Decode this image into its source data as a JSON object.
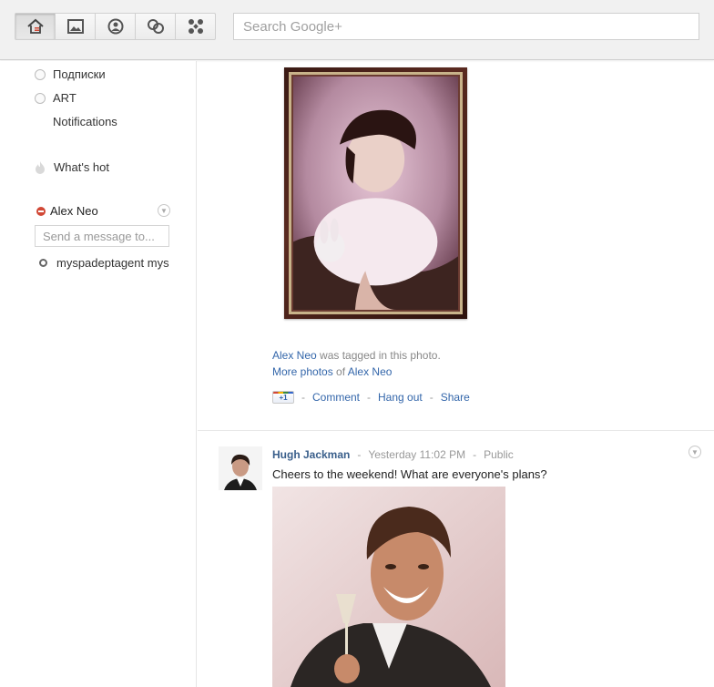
{
  "search": {
    "placeholder": "Search Google+"
  },
  "nav": {
    "buttons": [
      {
        "icon": "home-icon",
        "active": true
      },
      {
        "icon": "photos-icon",
        "active": false
      },
      {
        "icon": "profile-icon",
        "active": false
      },
      {
        "icon": "circles-icon",
        "active": false
      },
      {
        "icon": "games-icon",
        "active": false
      }
    ]
  },
  "sidebar": {
    "streams": [
      {
        "label": "Подписки"
      },
      {
        "label": "ART"
      },
      {
        "label": "Notifications"
      }
    ],
    "whats_hot": "What's hot",
    "chat": {
      "user_name": "Alex Neo",
      "message_placeholder": "Send a message to...",
      "contacts": [
        {
          "name": "myspadeptagent mys"
        }
      ]
    }
  },
  "stream": {
    "photo_post": {
      "tagged_name": "Alex Neo",
      "tagged_text": " was tagged in this photo.",
      "more_photos": "More photos",
      "of_text": " of ",
      "more_photos_name": "Alex Neo",
      "actions": {
        "plus_one": "+1",
        "comment": "Comment",
        "hangout": "Hang out",
        "share": "Share",
        "separator": "-"
      }
    },
    "post": {
      "author": "Hugh Jackman",
      "time": "Yesterday 11:02 PM",
      "visibility": "Public",
      "separator": "-",
      "text": "Cheers to the weekend! What are everyone's plans?"
    }
  },
  "colors": {
    "link": "#3366aa",
    "busy": "#d14836",
    "author": "#3a5f8b"
  }
}
